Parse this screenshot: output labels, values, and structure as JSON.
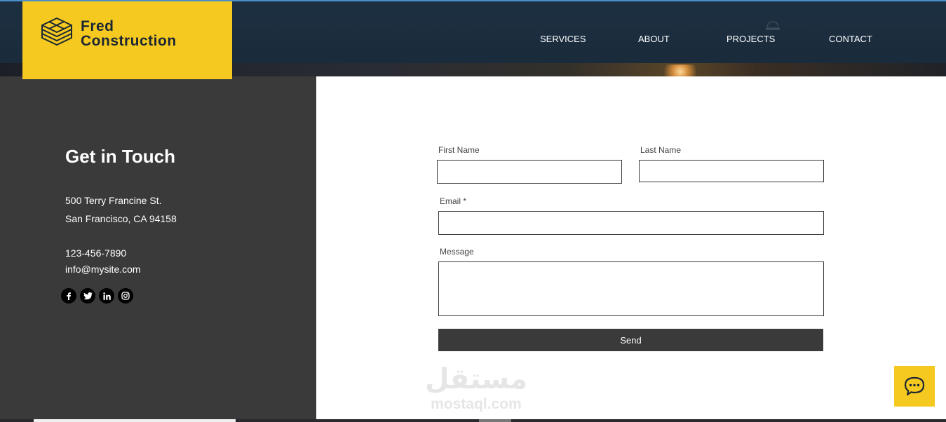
{
  "brand": {
    "line1": "Fred",
    "line2": "Construction",
    "accent_color": "#f5c91f",
    "icon": "layered-blocks-icon"
  },
  "nav": {
    "items": [
      {
        "label": "SERVICES"
      },
      {
        "label": "ABOUT"
      },
      {
        "label": "PROJECTS"
      },
      {
        "label": "CONTACT"
      }
    ]
  },
  "contact": {
    "title": "Get in Touch",
    "address_line1": "500 Terry Francine St.",
    "address_line2": "San Francisco, CA 94158",
    "phone": "123-456-7890",
    "email": "info@mysite.com",
    "socials": [
      "facebook-icon",
      "twitter-icon",
      "linkedin-icon",
      "instagram-icon"
    ]
  },
  "form": {
    "first_name_label": "First Name",
    "last_name_label": "Last Name",
    "email_label": "Email *",
    "message_label": "Message",
    "send_label": "Send"
  },
  "watermark": {
    "arabic": "مستقل",
    "latin": "mostaql.com"
  },
  "chat": {
    "icon": "chat-bubble-icon"
  },
  "colors": {
    "header_bg": "#1b2b3b",
    "left_panel_bg": "#3a3a3a",
    "button_bg": "#3a3a3a"
  }
}
